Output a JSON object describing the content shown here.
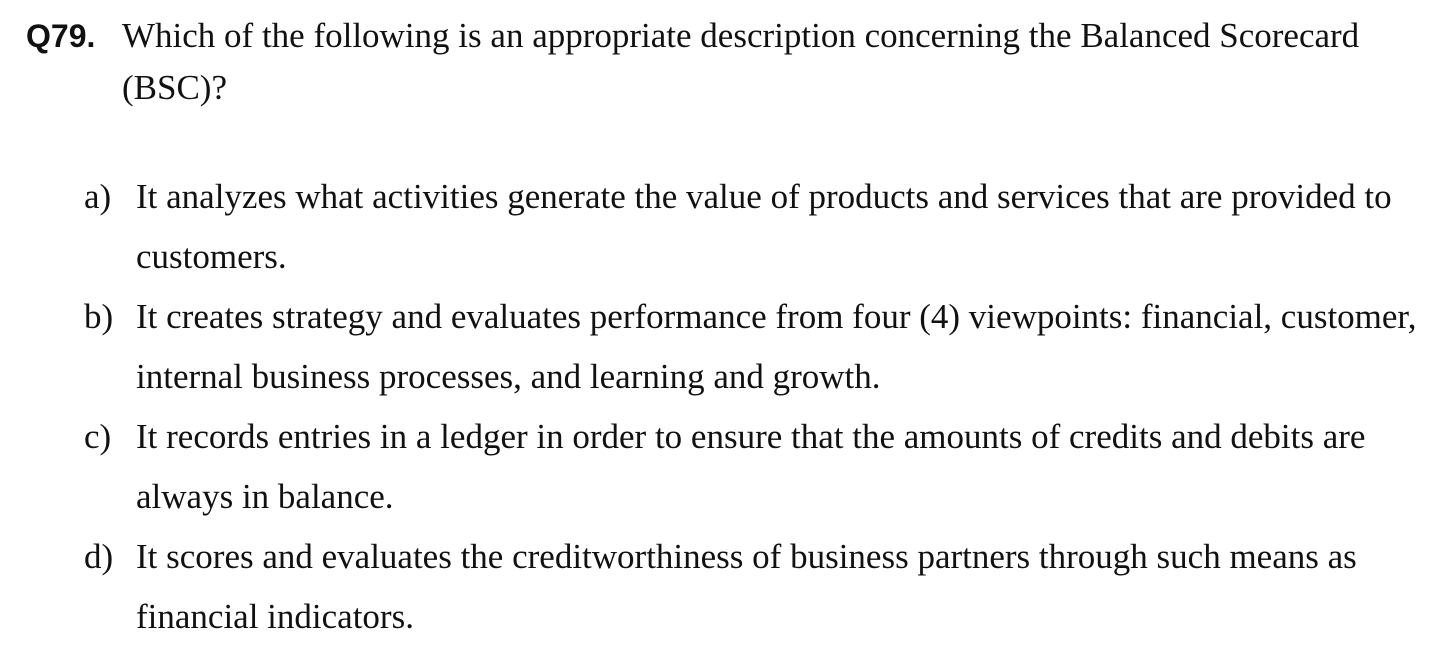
{
  "question": {
    "number": "Q79.",
    "text": "Which of the following is an appropriate description concerning the Balanced Scorecard (BSC)?"
  },
  "options": [
    {
      "label": "a)",
      "text": "It analyzes what activities generate the value of products and services that are provided to customers."
    },
    {
      "label": "b)",
      "text": "It creates strategy and evaluates performance from four (4) viewpoints: financial, customer, internal business processes, and learning and growth."
    },
    {
      "label": "c)",
      "text": "It records entries in a ledger in order to ensure that the amounts of credits and debits are always in balance."
    },
    {
      "label": "d)",
      "text": "It scores and evaluates the creditworthiness of business partners through such means as financial indicators."
    }
  ]
}
